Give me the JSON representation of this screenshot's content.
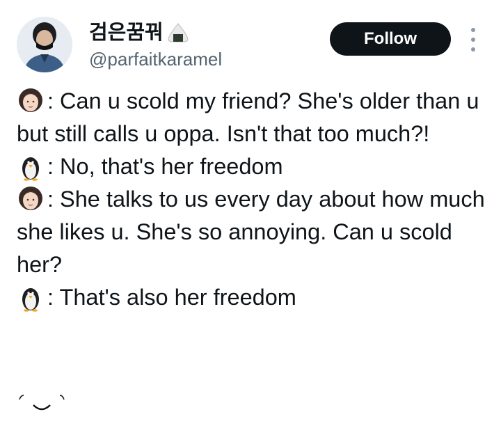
{
  "author": {
    "display_name": "검은꿈꿔",
    "handle": "@parfaitkaramel",
    "name_emoji": "rice-ball-icon",
    "avatar": "profile-avatar"
  },
  "actions": {
    "follow_label": "Follow",
    "more_icon": "more-vertical-icon"
  },
  "tweet": {
    "lines": [
      {
        "speaker_icon": "woman-face-icon",
        "text": ": Can u scold my friend? She's older than u but still calls u oppa. Isn't that too much?!"
      },
      {
        "speaker_icon": "penguin-icon",
        "text": ": No, that's her freedom"
      },
      {
        "speaker_icon": "woman-face-icon",
        "text": ": She talks to us every day about how much she likes u. She's so annoying. Can u scold her?"
      },
      {
        "speaker_icon": "penguin-icon",
        "text": ": That's also her freedom"
      }
    ],
    "closing_emoticon": "smile-emoticon"
  },
  "colors": {
    "text": "#0f1419",
    "secondary_text": "#536471",
    "button_bg": "#0f1419",
    "button_text": "#ffffff"
  }
}
